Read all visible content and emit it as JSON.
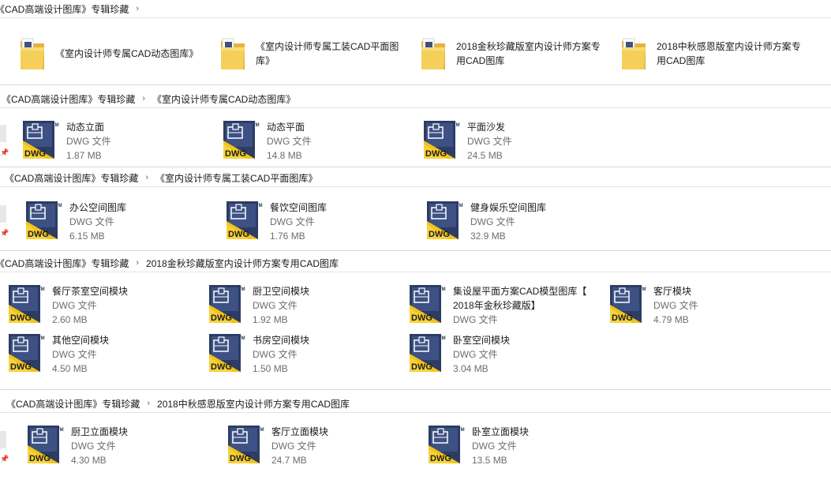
{
  "panels": [
    {
      "breadcrumb": [
        "《CAD高端设计图库》专辑珍藏"
      ],
      "folders": [
        "《室内设计师专属CAD动态图库》",
        "《室内设计师专属工装CAD平面图库》",
        "2018金秋珍藏版室内设计师方案专用CAD图库",
        "2018中秋感恩版室内设计师方案专用CAD图库"
      ]
    },
    {
      "breadcrumb": [
        "《CAD高端设计图库》专辑珍藏",
        "《室内设计师专属CAD动态图库》"
      ],
      "files": [
        {
          "name": "动态立面",
          "type": "DWG 文件",
          "size": "1.87 MB"
        },
        {
          "name": "动态平面",
          "type": "DWG 文件",
          "size": "14.8 MB"
        },
        {
          "name": "平面沙发",
          "type": "DWG 文件",
          "size": "24.5 MB"
        }
      ]
    },
    {
      "breadcrumb": [
        "《CAD高端设计图库》专辑珍藏",
        "《室内设计师专属工装CAD平面图库》"
      ],
      "files": [
        {
          "name": "办公空间图库",
          "type": "DWG 文件",
          "size": "6.15 MB"
        },
        {
          "name": "餐饮空间图库",
          "type": "DWG 文件",
          "size": "1.76 MB"
        },
        {
          "name": "健身娱乐空间图库",
          "type": "DWG 文件",
          "size": "32.9 MB"
        }
      ]
    },
    {
      "breadcrumb": [
        "《CAD高端设计图库》专辑珍藏",
        "2018金秋珍藏版室内设计师方案专用CAD图库"
      ],
      "files": [
        {
          "name": "餐厅茶室空间模块",
          "type": "DWG 文件",
          "size": "2.60 MB"
        },
        {
          "name": "厨卫空间模块",
          "type": "DWG 文件",
          "size": "1.92 MB"
        },
        {
          "name": "集设屋平面方案CAD模型图库【",
          "name2": "2018年金秋珍藏版】",
          "type": "DWG 文件",
          "size": ""
        },
        {
          "name": "客厅模块",
          "type": "DWG 文件",
          "size": "4.79 MB"
        },
        {
          "name": "其他空间模块",
          "type": "DWG 文件",
          "size": "4.50 MB"
        },
        {
          "name": "书房空间模块",
          "type": "DWG 文件",
          "size": "1.50 MB"
        },
        {
          "name": "卧室空间模块",
          "type": "DWG 文件",
          "size": "3.04 MB"
        }
      ]
    },
    {
      "breadcrumb": [
        "《CAD高端设计图库》专辑珍藏",
        "2018中秋感恩版室内设计师方案专用CAD图库"
      ],
      "files": [
        {
          "name": "厨卫立面模块",
          "type": "DWG 文件",
          "size": "4.30 MB"
        },
        {
          "name": "客厅立面模块",
          "type": "DWG 文件",
          "size": "24.7 MB"
        },
        {
          "name": "卧室立面模块",
          "type": "DWG 文件",
          "size": "13.5 MB"
        }
      ]
    }
  ],
  "icon": {
    "dwg_label": "DWG",
    "tm": "TM"
  },
  "colors": {
    "dwg_yellow": "#f2c418",
    "dwg_navy": "#2c3c63",
    "folder": "#f0c050"
  }
}
